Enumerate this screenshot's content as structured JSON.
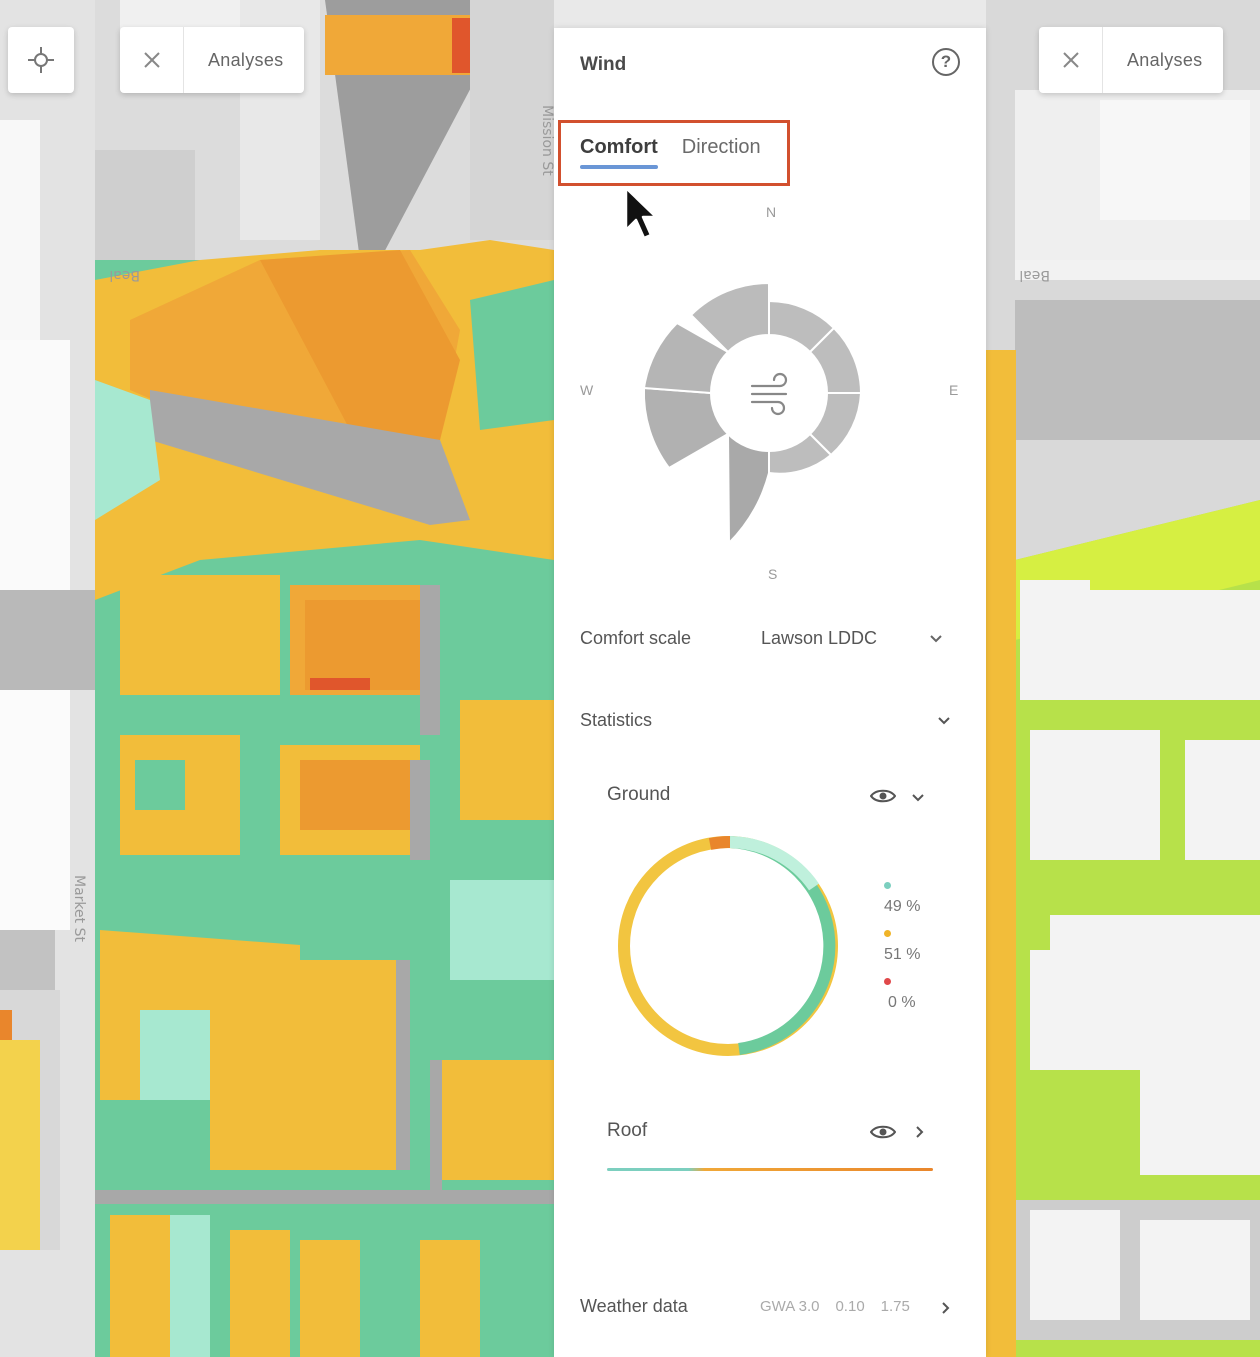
{
  "map": {
    "locate_icon": "crosshair-icon",
    "left_analyses": {
      "label": "Analyses",
      "icon": "close-icon"
    },
    "right_analyses": {
      "label": "Analyses",
      "icon": "close-icon"
    },
    "street_labels": [
      "Mission St",
      "Beal",
      "Market St",
      "Beal"
    ]
  },
  "panel": {
    "title": "Wind",
    "help_icon": "?",
    "tabs": [
      {
        "label": "Comfort",
        "active": true
      },
      {
        "label": "Direction",
        "active": false
      }
    ],
    "compass": {
      "n": "N",
      "w": "W",
      "e": "E",
      "s": "S"
    },
    "center_icon": "wind-icon",
    "comfort_scale": {
      "label": "Comfort scale",
      "value": "Lawson LDDC"
    },
    "statistics": {
      "label": "Statistics"
    },
    "ground": {
      "label": "Ground",
      "legend": [
        {
          "color": "#7ccfbf",
          "pct": "49 %"
        },
        {
          "color": "#f0b428",
          "pct": "51 %"
        },
        {
          "color": "#e0484a",
          "pct": "0 %"
        }
      ]
    },
    "roof": {
      "label": "Roof"
    },
    "weather": {
      "label": "Weather data",
      "meta": [
        "GWA 3.0",
        "0.10",
        "1.75"
      ]
    }
  },
  "colors": {
    "accent_tab": "#6a96d6",
    "highlight_box": "#d2502e",
    "comfort_green": "#7ccfbf",
    "comfort_orange": "#f0b428",
    "comfort_red": "#e0484a"
  }
}
